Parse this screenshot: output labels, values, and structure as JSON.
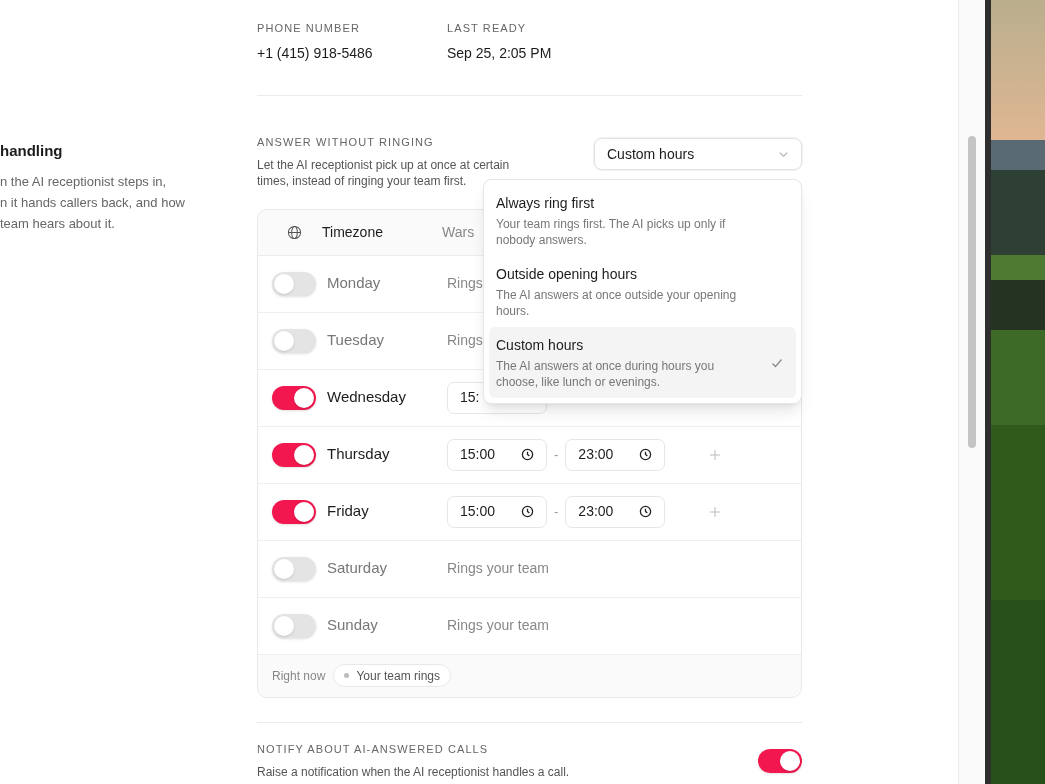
{
  "info": [
    {
      "label": "PHONE NUMBER",
      "value": "+1 (415) 918-5486"
    },
    {
      "label": "LAST READY",
      "value": "Sep 25, 2:05 PM"
    }
  ],
  "section": {
    "title": "handling",
    "description_lines": [
      "n the AI receptionist steps in,",
      "n it hands callers back, and how",
      "team hears about it."
    ]
  },
  "answer": {
    "label": "ANSWER WITHOUT RINGING",
    "description": "Let the AI receptionist pick up at once at certain times, instead of ringing your team first.",
    "select": {
      "value": "Custom hours",
      "expanded": true
    },
    "options": [
      {
        "title": "Always ring first",
        "description": "Your team rings first. The AI picks up only if nobody answers.",
        "selected": false
      },
      {
        "title": "Outside opening hours",
        "description": "The AI answers at once outside your opening hours.",
        "selected": false
      },
      {
        "title": "Custom hours",
        "description": "The AI answers at once during hours you choose, like lunch or evenings.",
        "selected": true
      }
    ]
  },
  "timezone": {
    "label": "Timezone",
    "value": "Wars"
  },
  "days": [
    {
      "name": "Monday",
      "on": false,
      "status": "Rings"
    },
    {
      "name": "Tuesday",
      "on": false,
      "status": "Rings"
    },
    {
      "name": "Wednesday",
      "on": true,
      "start": "15:"
    },
    {
      "name": "Thursday",
      "on": true,
      "start": "15:00",
      "separator": "-",
      "end": "23:00"
    },
    {
      "name": "Friday",
      "on": true,
      "start": "15:00",
      "separator": "-",
      "end": "23:00"
    },
    {
      "name": "Saturday",
      "on": false,
      "status": "Rings your team"
    },
    {
      "name": "Sunday",
      "on": false,
      "status": "Rings your team"
    }
  ],
  "right_now": {
    "label": "Right now",
    "badge": "Your team rings"
  },
  "notify": {
    "label": "NOTIFY ABOUT AI-ANSWERED CALLS",
    "description": "Raise a notification when the AI receptionist handles a call.",
    "on": true
  }
}
